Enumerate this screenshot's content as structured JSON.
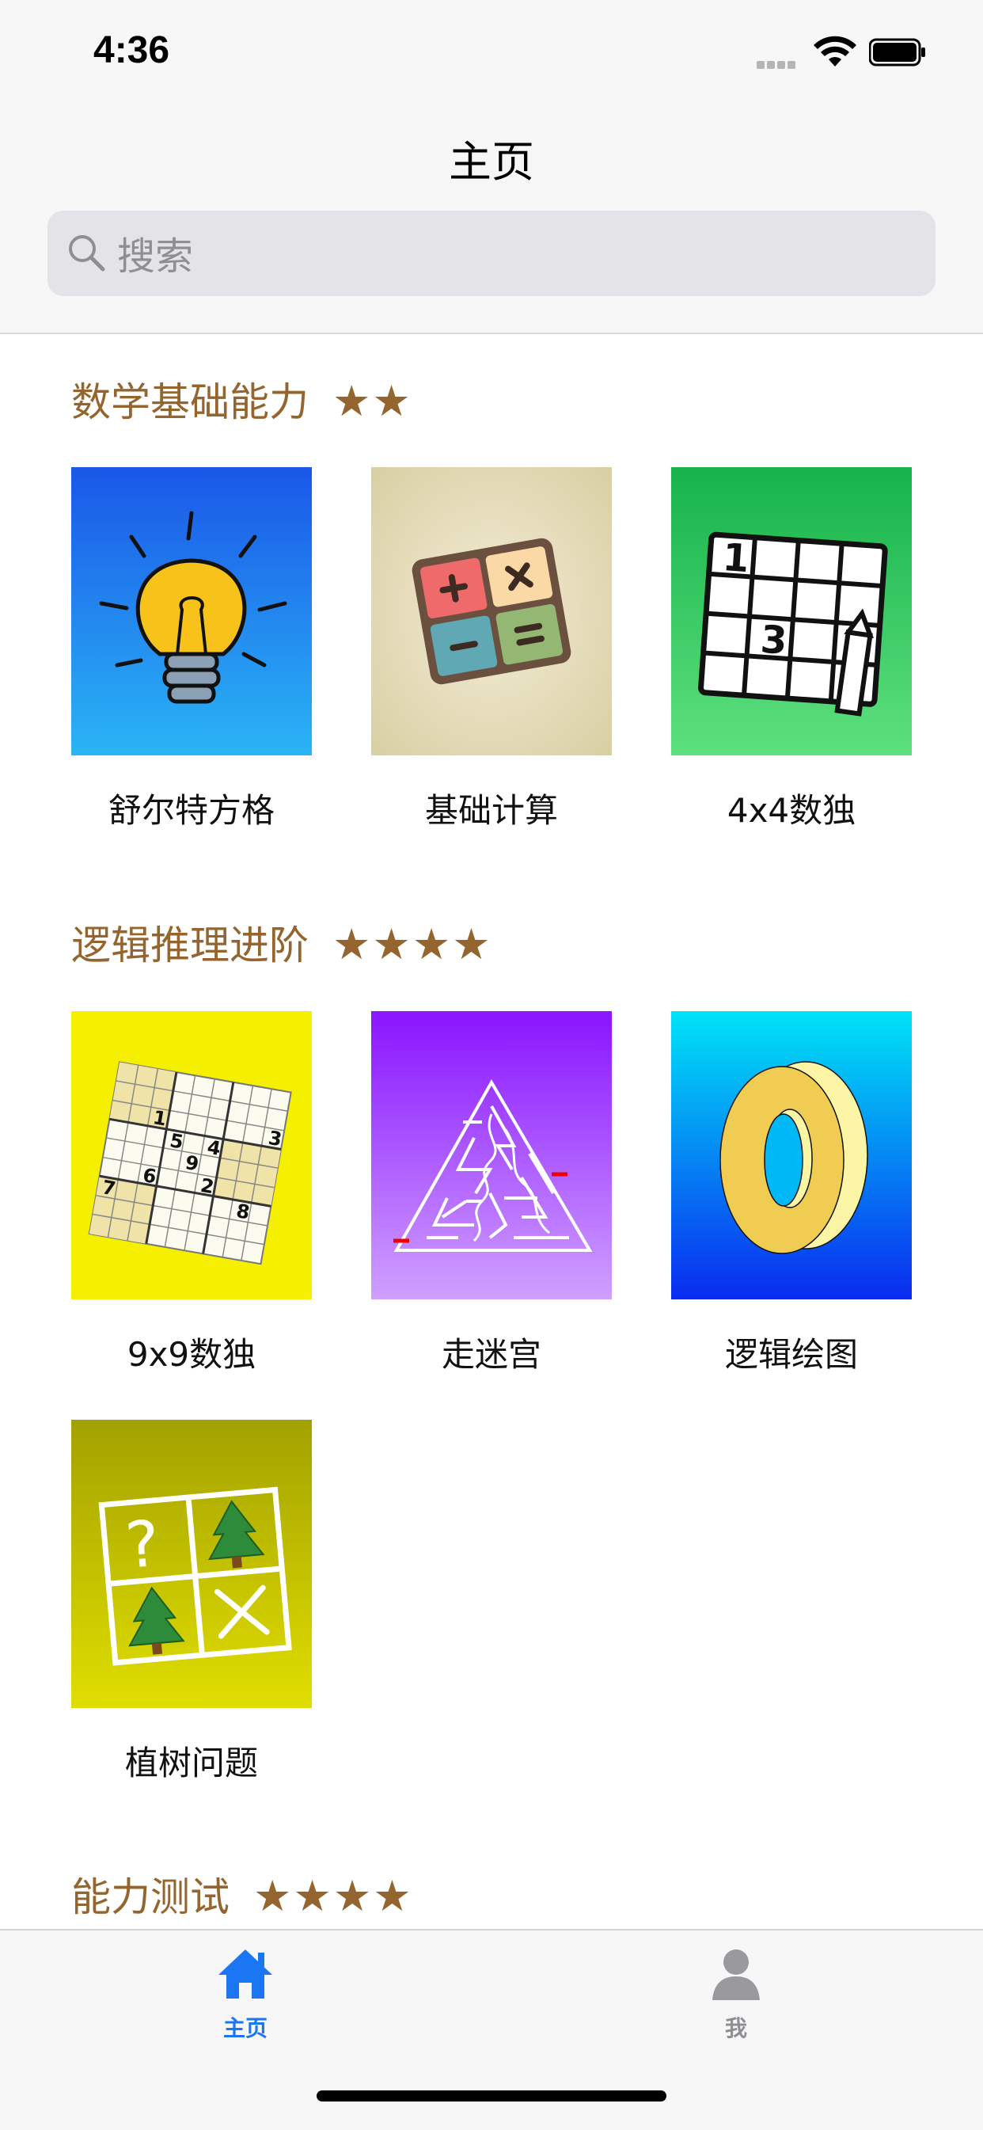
{
  "status_bar": {
    "time": "4:36"
  },
  "nav": {
    "title": "主页"
  },
  "search": {
    "placeholder": "搜索"
  },
  "sections": [
    {
      "title": "数学基础能力",
      "stars": "★★",
      "items": [
        {
          "label": "舒尔特方格",
          "icon": "lightbulb-icon",
          "bg": [
            "#1a57e8",
            "#2ab4f5"
          ]
        },
        {
          "label": "基础计算",
          "icon": "calculator-icon",
          "bg": [
            "#efe8cc",
            "#d6cda8"
          ]
        },
        {
          "label": "4x4数独",
          "icon": "sudoku-4x4-icon",
          "bg": [
            "#16b34a",
            "#5ee07f"
          ]
        }
      ]
    },
    {
      "title": "逻辑推理进阶",
      "stars": "★★★★",
      "items": [
        {
          "label": "9x9数独",
          "icon": "sudoku-9x9-icon",
          "bg": [
            "#f4f000",
            "#f4f000"
          ]
        },
        {
          "label": "走迷宫",
          "icon": "maze-icon",
          "bg": [
            "#8a14ff",
            "#cfa0ff"
          ]
        },
        {
          "label": "逻辑绘图",
          "icon": "impossible-ring-icon",
          "bg": [
            "#00e4f7",
            "#0a2bf0"
          ]
        },
        {
          "label": "植树问题",
          "icon": "tree-grid-icon",
          "bg": [
            "#a3a100",
            "#e0de00"
          ]
        }
      ]
    },
    {
      "title": "能力测试",
      "stars": "★★★★"
    }
  ],
  "tabs": [
    {
      "label": "主页",
      "icon": "home-icon",
      "active": true,
      "color": "#1a76f2"
    },
    {
      "label": "我",
      "icon": "person-icon",
      "active": false,
      "color": "#8e8e93"
    }
  ],
  "colors": {
    "accent": "#1a76f2",
    "section": "#94652e"
  }
}
